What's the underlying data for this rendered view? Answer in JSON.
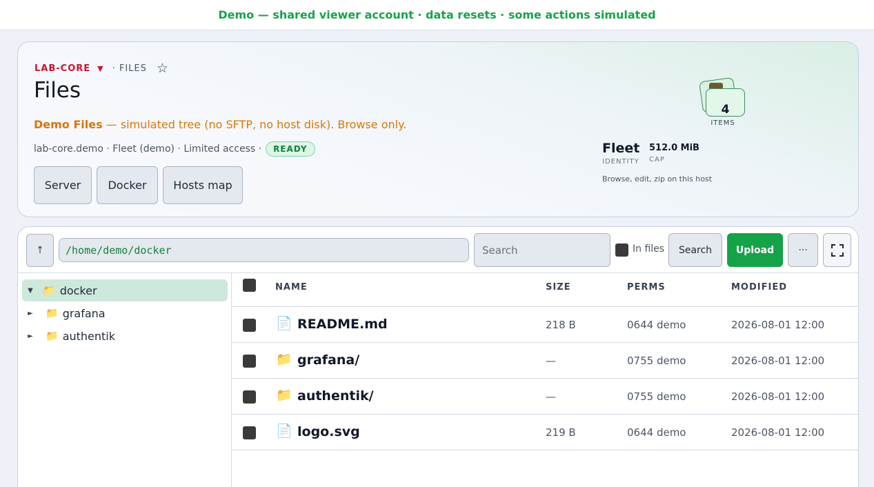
{
  "banner": {
    "text": "Demo — shared viewer account · data resets · some actions simulated"
  },
  "hero": {
    "host": "LAB-CORE",
    "caret": "▼",
    "section": "· FILES",
    "star": "☆",
    "title": "Files",
    "demo_strong": "Demo Files",
    "demo_rest": " — simulated tree (no SFTP, no host disk). Browse only.",
    "meta": "lab-core.demo · Fleet (demo) · Limited access ·",
    "status": "READY",
    "buttons": {
      "server": "Server",
      "docker": "Docker",
      "hosts_map": "Hosts map"
    },
    "items_count": "4",
    "items_label": "ITEMS",
    "fleet": "Fleet",
    "fleet_sub": "IDENTITY",
    "cap": "512.0 MiB",
    "cap_sub": "CAP",
    "hint": "Browse, edit, zip on this host"
  },
  "toolbar": {
    "up": "↑",
    "path": "/home/demo/docker",
    "search_placeholder": "Search",
    "in_files": "In files",
    "search_btn": "Search",
    "upload_btn": "Upload",
    "more_btn": "···"
  },
  "tree": {
    "root": {
      "caret": "▼",
      "icon": "📁",
      "label": "docker"
    },
    "children": [
      {
        "caret": "►",
        "icon": "📁",
        "label": "grafana"
      },
      {
        "caret": "►",
        "icon": "📁",
        "label": "authentik"
      }
    ]
  },
  "table": {
    "columns": {
      "name": "NAME",
      "size": "SIZE",
      "perms": "PERMS",
      "modified": "MODIFIED"
    },
    "rows": [
      {
        "icon": "📄",
        "name": "README.md",
        "size": "218 B",
        "perms": "0644 demo",
        "modified": "2026-08-01 12:00"
      },
      {
        "icon": "📁",
        "name": "grafana/",
        "size": "—",
        "perms": "0755 demo",
        "modified": "2026-08-01 12:00"
      },
      {
        "icon": "📁",
        "name": "authentik/",
        "size": "—",
        "perms": "0755 demo",
        "modified": "2026-08-01 12:00"
      },
      {
        "icon": "📄",
        "name": "logo.svg",
        "size": "219 B",
        "perms": "0644 demo",
        "modified": "2026-08-01 12:00"
      }
    ]
  }
}
